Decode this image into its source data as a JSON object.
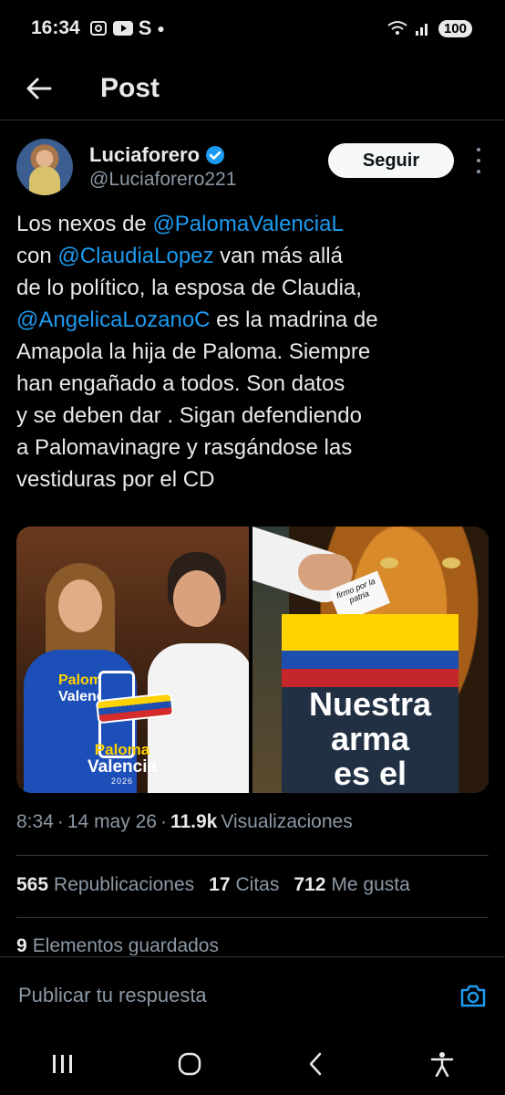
{
  "status_bar": {
    "time": "16:34",
    "left_icons": [
      "screenshot-icon",
      "youtube-icon",
      "s-app-icon",
      "dot-icon"
    ],
    "s_glyph": "S",
    "right_icons": [
      "wifi-icon",
      "signal-icon"
    ],
    "battery": "100"
  },
  "header": {
    "title": "Post"
  },
  "author": {
    "display_name": "Luciaforero",
    "handle": "@Luciaforero221",
    "verified": true,
    "follow_label": "Seguir"
  },
  "tweet": {
    "segments": [
      {
        "t": "Los nexos de ",
        "mention": false
      },
      {
        "t": "@PalomaValenciaL",
        "mention": true
      },
      {
        "t": "\ncon ",
        "mention": false
      },
      {
        "t": "@ClaudiaLopez",
        "mention": true
      },
      {
        "t": " van más allá\nde lo político, la esposa de Claudia,\n",
        "mention": false
      },
      {
        "t": "@AngelicaLozanoC",
        "mention": true
      },
      {
        "t": " es la madrina de\nAmapola la hija de Paloma. Siempre\nhan engañado a todos. Son datos\ny se deben dar . Sigan defendiendo\na Palomavinagre y rasgándose las\nvestiduras por el CD",
        "mention": false
      }
    ]
  },
  "media": {
    "left": {
      "shirt_line1": "Paloma",
      "shirt_line2": "Valencia",
      "logo_line1": "Paloma",
      "logo_line2": "Valencia",
      "logo_year": "2026"
    },
    "right": {
      "ballot_text": "firmo por la patria",
      "box_line1": "Nuestra",
      "box_line2": "arma",
      "box_line3": "es el"
    }
  },
  "meta": {
    "time": "8:34",
    "sep1": "·",
    "date": "14 may 26",
    "sep2": "·",
    "views": "11.9k",
    "views_label": "Visualizaciones"
  },
  "stats": {
    "reposts": "565",
    "reposts_label": "Republicaciones",
    "quotes": "17",
    "quotes_label": "Citas",
    "likes": "712",
    "likes_label": "Me gusta",
    "bookmarks": "9",
    "bookmarks_label": "Elementos guardados"
  },
  "reply": {
    "placeholder": "Publicar tu respuesta"
  },
  "colors": {
    "background": "#000000",
    "text": "#e7e9ea",
    "secondary": "#8b98a5",
    "accent": "#1d9bf0",
    "divider": "#2f3336"
  }
}
